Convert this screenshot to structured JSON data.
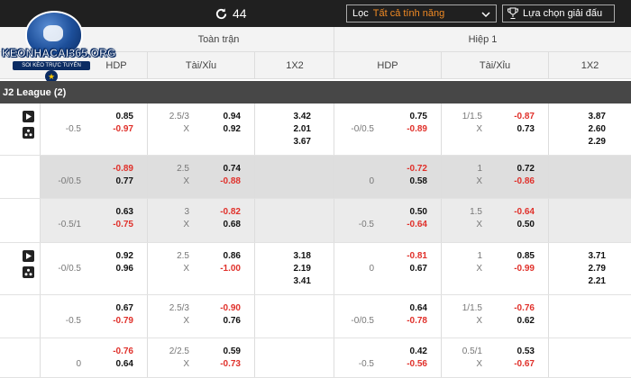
{
  "toolbar": {
    "refresh_count": "44",
    "filter_label": "Lọc",
    "filter_value": "Tất cả tính năng",
    "league_button": "Lựa chọn giải đấu"
  },
  "logo": {
    "name": "KEONHACAI365.ORG",
    "tagline": "SOI KÈO TRỰC TUYẾN"
  },
  "header": {
    "full_time": "Toàn trận",
    "first_half": "Hiệp 1",
    "cols": [
      "HDP",
      "Tài/Xỉu",
      "1X2",
      "HDP",
      "Tài/Xỉu",
      "1X2"
    ]
  },
  "league": {
    "name": "J2 League (2)"
  },
  "matches": [
    {
      "rows": [
        {
          "ft_hdp_line": "-0.5",
          "ft_hdp_home": "0.85",
          "ft_hdp_away": "-0.97",
          "ft_ou_line": "2.5/3",
          "ft_ou_x": "X",
          "ft_ou_over": "0.94",
          "ft_ou_under": "0.92",
          "ft_1x2": [
            "3.42",
            "2.01",
            "3.67"
          ],
          "h1_hdp_line": "-0/0.5",
          "h1_hdp_home": "0.75",
          "h1_hdp_away": "-0.89",
          "h1_ou_line": "1/1.5",
          "h1_ou_x": "X",
          "h1_ou_over": "-0.87",
          "h1_ou_under": "0.73",
          "h1_1x2": [
            "3.87",
            "2.60",
            "2.29"
          ]
        },
        {
          "ft_hdp_line": "-0/0.5",
          "ft_hdp_home": "-0.89",
          "ft_hdp_away": "0.77",
          "ft_ou_line": "2.5",
          "ft_ou_x": "X",
          "ft_ou_over": "0.74",
          "ft_ou_under": "-0.88",
          "h1_hdp_line": "0",
          "h1_hdp_home": "-0.72",
          "h1_hdp_away": "0.58",
          "h1_ou_line": "1",
          "h1_ou_x": "X",
          "h1_ou_over": "0.72",
          "h1_ou_under": "-0.86"
        },
        {
          "ft_hdp_line": "-0.5/1",
          "ft_hdp_home": "0.63",
          "ft_hdp_away": "-0.75",
          "ft_ou_line": "3",
          "ft_ou_x": "X",
          "ft_ou_over": "-0.82",
          "ft_ou_under": "0.68",
          "h1_hdp_line": "-0.5",
          "h1_hdp_home": "0.50",
          "h1_hdp_away": "-0.64",
          "h1_ou_line": "1.5",
          "h1_ou_x": "X",
          "h1_ou_over": "-0.64",
          "h1_ou_under": "0.50"
        }
      ]
    },
    {
      "rows": [
        {
          "ft_hdp_line": "-0/0.5",
          "ft_hdp_home": "0.92",
          "ft_hdp_away": "0.96",
          "ft_ou_line": "2.5",
          "ft_ou_x": "X",
          "ft_ou_over": "0.86",
          "ft_ou_under": "-1.00",
          "ft_1x2": [
            "3.18",
            "2.19",
            "3.41"
          ],
          "h1_hdp_line": "0",
          "h1_hdp_home": "-0.81",
          "h1_hdp_away": "0.67",
          "h1_ou_line": "1",
          "h1_ou_x": "X",
          "h1_ou_over": "0.85",
          "h1_ou_under": "-0.99",
          "h1_1x2": [
            "3.71",
            "2.79",
            "2.21"
          ]
        },
        {
          "ft_hdp_line": "-0.5",
          "ft_hdp_home": "0.67",
          "ft_hdp_away": "-0.79",
          "ft_ou_line": "2.5/3",
          "ft_ou_x": "X",
          "ft_ou_over": "-0.90",
          "ft_ou_under": "0.76",
          "h1_hdp_line": "-0/0.5",
          "h1_hdp_home": "0.64",
          "h1_hdp_away": "-0.78",
          "h1_ou_line": "1/1.5",
          "h1_ou_x": "X",
          "h1_ou_over": "-0.76",
          "h1_ou_under": "0.62"
        },
        {
          "ft_hdp_line": "0",
          "ft_hdp_home": "-0.76",
          "ft_hdp_away": "0.64",
          "ft_ou_line": "2/2.5",
          "ft_ou_x": "X",
          "ft_ou_over": "0.59",
          "ft_ou_under": "-0.73",
          "h1_hdp_line": "-0.5",
          "h1_hdp_home": "0.42",
          "h1_hdp_away": "-0.56",
          "h1_ou_line": "0.5/1",
          "h1_ou_x": "X",
          "h1_ou_over": "0.53",
          "h1_ou_under": "-0.67"
        }
      ]
    }
  ],
  "colors": {
    "negative": "#e0302a",
    "accent": "#f08a24",
    "league_bar": "#474747",
    "topbar": "#202020"
  }
}
